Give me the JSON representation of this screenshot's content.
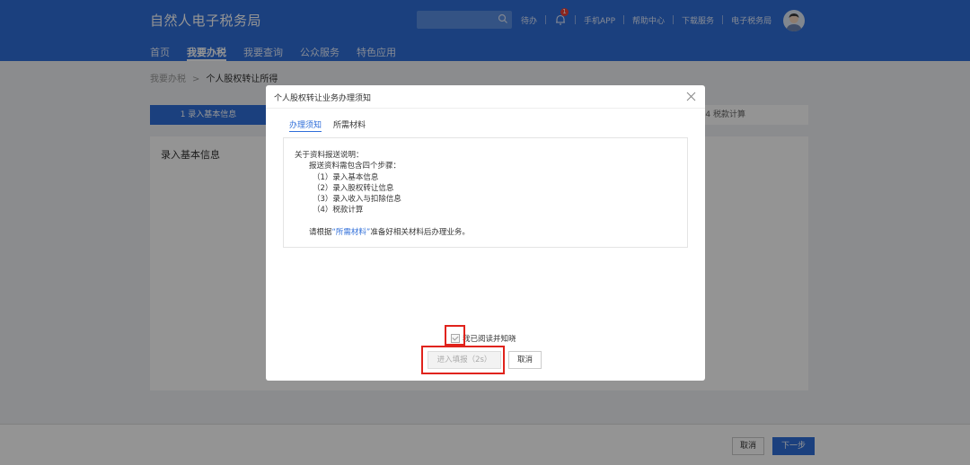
{
  "header": {
    "logo": "自然人电子税务局",
    "top_links": [
      "待办",
      "手机APP",
      "帮助中心",
      "下载服务",
      "电子税务局"
    ],
    "notification_count": "1",
    "nav": [
      "首页",
      "我要办税",
      "我要查询",
      "公众服务",
      "特色应用"
    ],
    "active_nav": "我要办税"
  },
  "breadcrumb": {
    "parent": "我要办税",
    "arrow": ">",
    "current": "个人股权转让所得"
  },
  "steps": {
    "active_label": "1  录入基本信息",
    "last_label": "4  税款计算"
  },
  "card": {
    "title": "录入基本信息"
  },
  "footer": {
    "cancel": "取消",
    "next": "下一步"
  },
  "modal": {
    "title": "个人股权转让业务办理须知",
    "tabs": [
      "办理须知",
      "所需材料"
    ],
    "active_tab": "办理须知",
    "notice": {
      "line1": "关于资料报送说明：",
      "line2": "报送资料需包含四个步骤：",
      "steps": [
        "（1）录入基本信息",
        "（2）录入股权转让信息",
        "（3）录入收入与扣除信息",
        "（4）税款计算"
      ],
      "footer_prefix": "请根据",
      "footer_link": "“所需材料”",
      "footer_suffix": "准备好相关材料后办理业务。"
    },
    "agree_label": "我已阅读并知晓",
    "agree_checked": true,
    "enter_button": "进入填报（2s）",
    "cancel_button": "取消"
  },
  "colors": {
    "primary": "#2f6ed9",
    "highlight": "#e0231c"
  }
}
